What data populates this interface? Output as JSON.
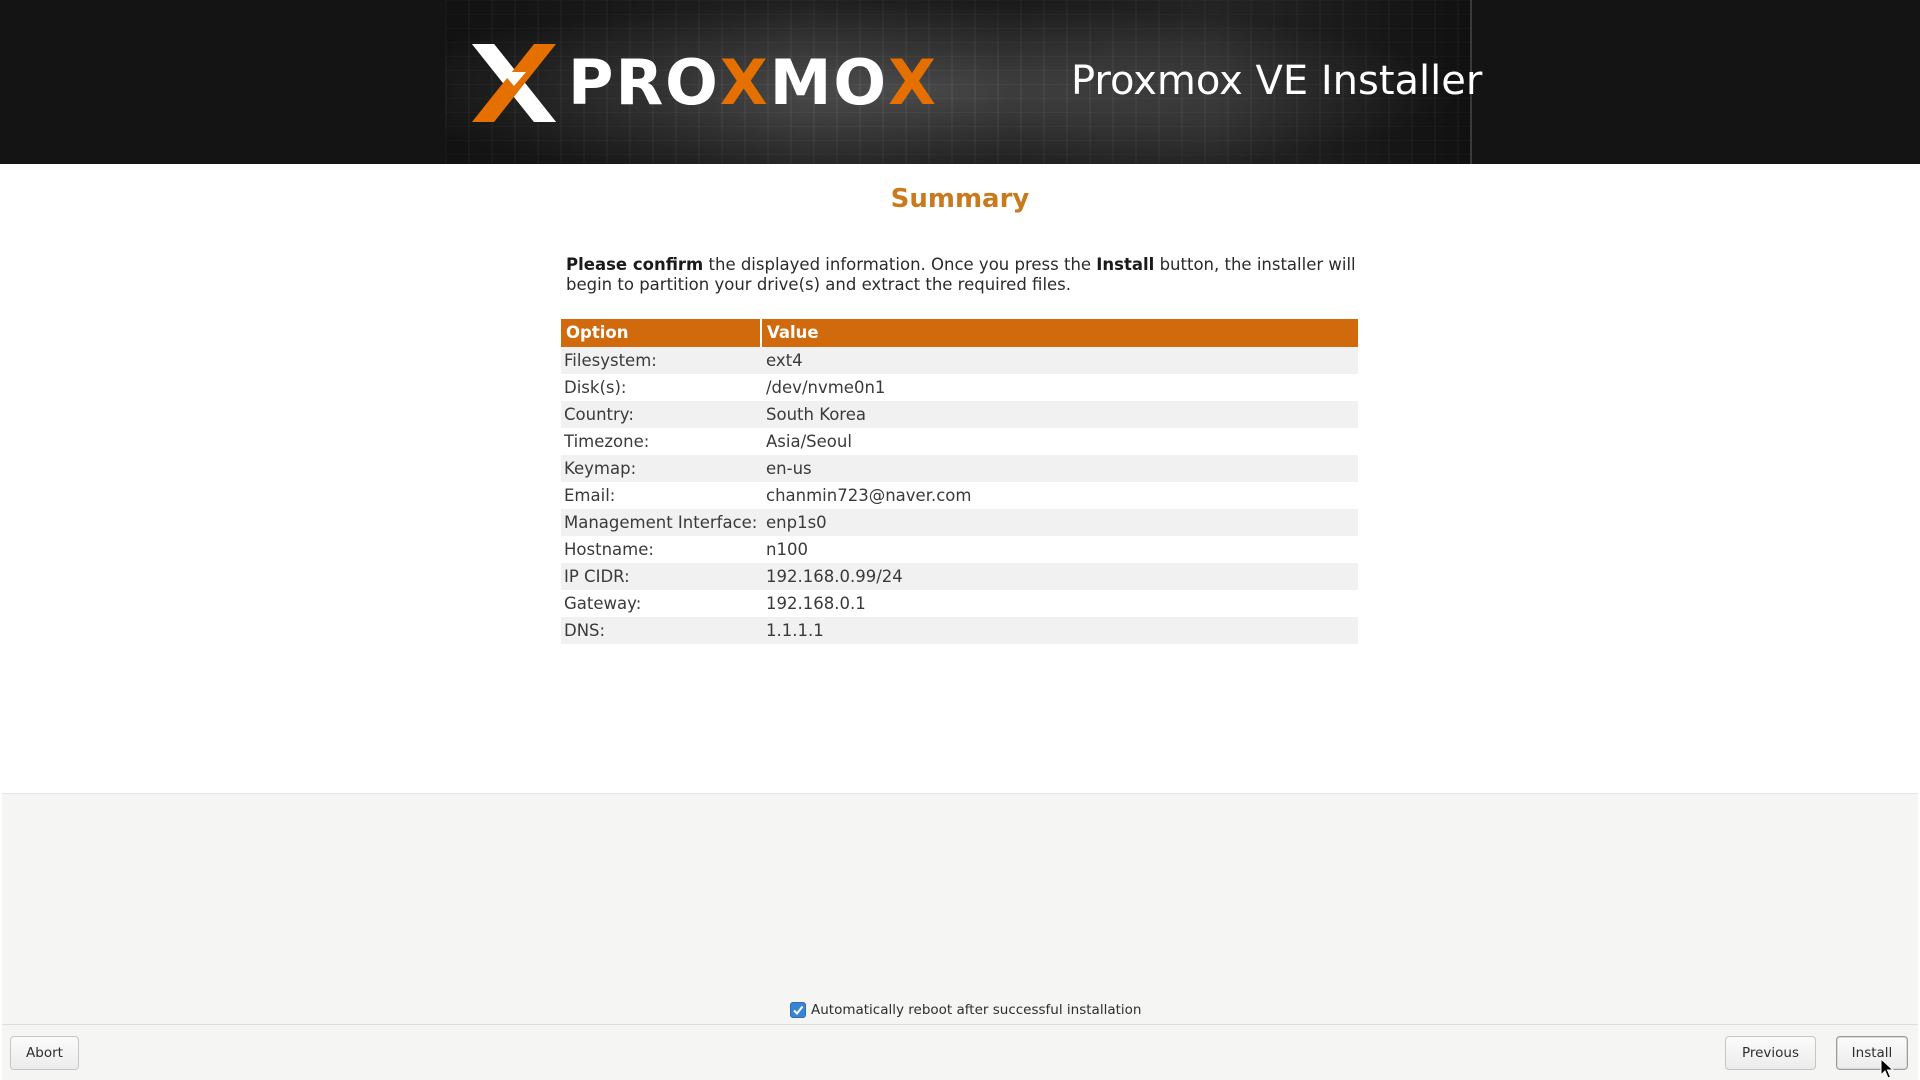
{
  "header": {
    "logo_part1": "PRO",
    "logo_part2": "X",
    "logo_part3": "MO",
    "logo_part4": "X",
    "installer_title": "Proxmox VE Installer"
  },
  "page": {
    "title": "Summary",
    "intro": {
      "bold_prefix": "Please confirm",
      "text_before_install": " the displayed information. Once you press the ",
      "install_word": "Install",
      "text_after_install": " button, the installer will begin to partition your drive(s) and extract the required files."
    }
  },
  "table": {
    "headers": [
      "Option",
      "Value"
    ],
    "rows": [
      {
        "option": "Filesystem:",
        "value": "ext4"
      },
      {
        "option": "Disk(s):",
        "value": "/dev/nvme0n1"
      },
      {
        "option": "Country:",
        "value": "South Korea"
      },
      {
        "option": "Timezone:",
        "value": "Asia/Seoul"
      },
      {
        "option": "Keymap:",
        "value": "en-us"
      },
      {
        "option": "Email:",
        "value": "chanmin723@naver.com"
      },
      {
        "option": "Management Interface:",
        "value": "enp1s0"
      },
      {
        "option": "Hostname:",
        "value": "n100"
      },
      {
        "option": "IP CIDR:",
        "value": "192.168.0.99/24"
      },
      {
        "option": "Gateway:",
        "value": "192.168.0.1"
      },
      {
        "option": "DNS:",
        "value": "1.1.1.1"
      }
    ]
  },
  "footer": {
    "reboot_label": "Automatically reboot after successful installation",
    "reboot_checked": true,
    "abort_label": "Abort",
    "previous_label": "Previous",
    "install_label": "Install"
  },
  "colors": {
    "accent": "#e57000",
    "table_header": "#d06a0c",
    "title": "#c97a1e",
    "checkbox": "#3b84d1"
  }
}
